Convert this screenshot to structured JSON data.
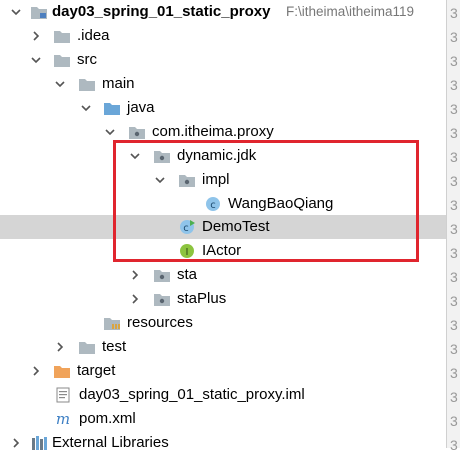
{
  "tree": {
    "project": {
      "name": "day03_spring_01_static_proxy",
      "path": "F:\\itheima\\itheima119"
    },
    "idea": ".idea",
    "src": "src",
    "main": "main",
    "java": "java",
    "package": "com.itheima.proxy",
    "dynamic_jdk": "dynamic.jdk",
    "impl": "impl",
    "wangbaoqiang": "WangBaoQiang",
    "demotest": "DemoTest",
    "iactor": "IActor",
    "sta": "sta",
    "staplus": "staPlus",
    "resources": "resources",
    "test": "test",
    "target": "target",
    "iml": "day03_spring_01_static_proxy.iml",
    "pom": "pom.xml",
    "external_libraries": "External Libraries"
  },
  "gutter": {
    "line_digit": "3"
  },
  "colors": {
    "folder": "#aeb9c0",
    "source_folder": "#6aa6d8",
    "target_folder": "#f0a35a",
    "class_icon": "#8fc4ea",
    "interface_icon": "#8cc43f",
    "highlight_border": "#e0252e",
    "selection": "#d5d5d5"
  }
}
